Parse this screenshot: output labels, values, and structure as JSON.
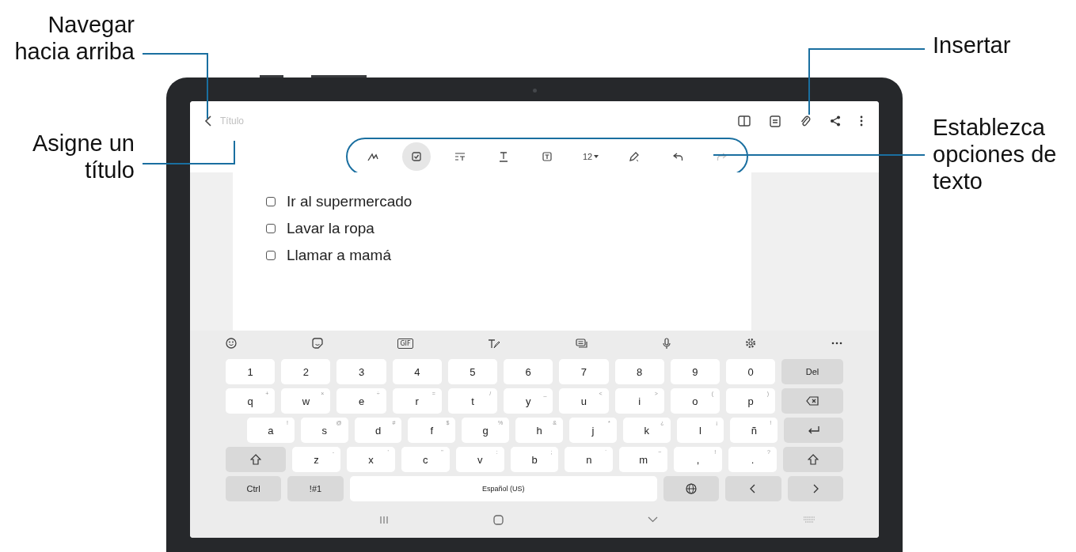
{
  "callouts": [
    {
      "text": "Navegar hacia arriba"
    },
    {
      "text": "Asigne un título"
    },
    {
      "text": "Insertar"
    },
    {
      "text": "Establezca opciones de texto"
    }
  ],
  "app_bar": {
    "title_placeholder": "Título",
    "actions": [
      {
        "kind": "book"
      },
      {
        "kind": "note"
      },
      {
        "kind": "attach"
      },
      {
        "kind": "share"
      },
      {
        "kind": "more"
      }
    ]
  },
  "text_toolbar": [
    {
      "kind": "handwriting",
      "selected": false,
      "disabled": false
    },
    {
      "kind": "checklist",
      "selected": true,
      "disabled": false
    },
    {
      "kind": "paragraph",
      "selected": false,
      "disabled": false
    },
    {
      "kind": "text-style",
      "selected": false,
      "disabled": false
    },
    {
      "kind": "text-box",
      "selected": false,
      "disabled": false
    },
    {
      "kind": "font-size",
      "label": "12",
      "selected": false,
      "disabled": false
    },
    {
      "kind": "pen",
      "selected": false,
      "disabled": false
    },
    {
      "kind": "undo",
      "selected": false,
      "disabled": false
    },
    {
      "kind": "redo",
      "selected": false,
      "disabled": true
    }
  ],
  "checklist": [
    {
      "text": "Ir al supermercado",
      "checked": false
    },
    {
      "text": "Lavar la ropa",
      "checked": false
    },
    {
      "text": "Llamar a mamá",
      "checked": false
    }
  ],
  "keyboard_toolbar": [
    {
      "kind": "emoji"
    },
    {
      "kind": "sticker"
    },
    {
      "kind": "gif",
      "label": "GIF"
    },
    {
      "kind": "handwriting"
    },
    {
      "kind": "clipboard"
    },
    {
      "kind": "mic"
    },
    {
      "kind": "settings"
    },
    {
      "kind": "more"
    }
  ],
  "keyboard_rows": [
    [
      {
        "kind": "char",
        "label": "1"
      },
      {
        "kind": "char",
        "label": "2"
      },
      {
        "kind": "char",
        "label": "3"
      },
      {
        "kind": "char",
        "label": "4"
      },
      {
        "kind": "char",
        "label": "5"
      },
      {
        "kind": "char",
        "label": "6"
      },
      {
        "kind": "char",
        "label": "7"
      },
      {
        "kind": "char",
        "label": "8"
      },
      {
        "kind": "char",
        "label": "9"
      },
      {
        "kind": "char",
        "label": "0"
      },
      {
        "kind": "function",
        "label": "Del"
      }
    ],
    [
      {
        "kind": "char",
        "label": "q",
        "hint": "+"
      },
      {
        "kind": "char",
        "label": "w",
        "hint": "×"
      },
      {
        "kind": "char",
        "label": "e",
        "hint": "÷"
      },
      {
        "kind": "char",
        "label": "r",
        "hint": "="
      },
      {
        "kind": "char",
        "label": "t",
        "hint": "/"
      },
      {
        "kind": "char",
        "label": "y",
        "hint": "_"
      },
      {
        "kind": "char",
        "label": "u",
        "hint": "<"
      },
      {
        "kind": "char",
        "label": "i",
        "hint": ">"
      },
      {
        "kind": "char",
        "label": "o",
        "hint": "("
      },
      {
        "kind": "char",
        "label": "p",
        "hint": ")"
      },
      {
        "kind": "backspace"
      }
    ],
    [
      {
        "kind": "char",
        "label": "a",
        "hint": "!"
      },
      {
        "kind": "char",
        "label": "s",
        "hint": "@"
      },
      {
        "kind": "char",
        "label": "d",
        "hint": "#"
      },
      {
        "kind": "char",
        "label": "f",
        "hint": "$"
      },
      {
        "kind": "char",
        "label": "g",
        "hint": "%"
      },
      {
        "kind": "char",
        "label": "h",
        "hint": "&"
      },
      {
        "kind": "char",
        "label": "j",
        "hint": "*"
      },
      {
        "kind": "char",
        "label": "k",
        "hint": "¿"
      },
      {
        "kind": "char",
        "label": "l",
        "hint": "¡"
      },
      {
        "kind": "char",
        "label": "ñ",
        "hint": "!"
      },
      {
        "kind": "enter"
      }
    ],
    [
      {
        "kind": "shift"
      },
      {
        "kind": "char",
        "label": "z",
        "hint": "-"
      },
      {
        "kind": "char",
        "label": "x",
        "hint": "'"
      },
      {
        "kind": "char",
        "label": "c",
        "hint": "\""
      },
      {
        "kind": "char",
        "label": "v",
        "hint": ":"
      },
      {
        "kind": "char",
        "label": "b",
        "hint": ";"
      },
      {
        "kind": "char",
        "label": "n",
        "hint": "`"
      },
      {
        "kind": "char",
        "label": "m",
        "hint": "~"
      },
      {
        "kind": "char",
        "label": ",",
        "hint": "!"
      },
      {
        "kind": "char",
        "label": ".",
        "hint": "?"
      },
      {
        "kind": "shift"
      }
    ],
    [
      {
        "kind": "function",
        "label": "Ctrl"
      },
      {
        "kind": "function",
        "label": "!#1"
      },
      {
        "kind": "space",
        "label": "Español (US)"
      },
      {
        "kind": "globe"
      },
      {
        "kind": "left"
      },
      {
        "kind": "right"
      }
    ]
  ],
  "nav_bar": [
    {
      "kind": "recents"
    },
    {
      "kind": "home"
    },
    {
      "kind": "hide-keyboard"
    },
    {
      "kind": "keyboard"
    }
  ]
}
